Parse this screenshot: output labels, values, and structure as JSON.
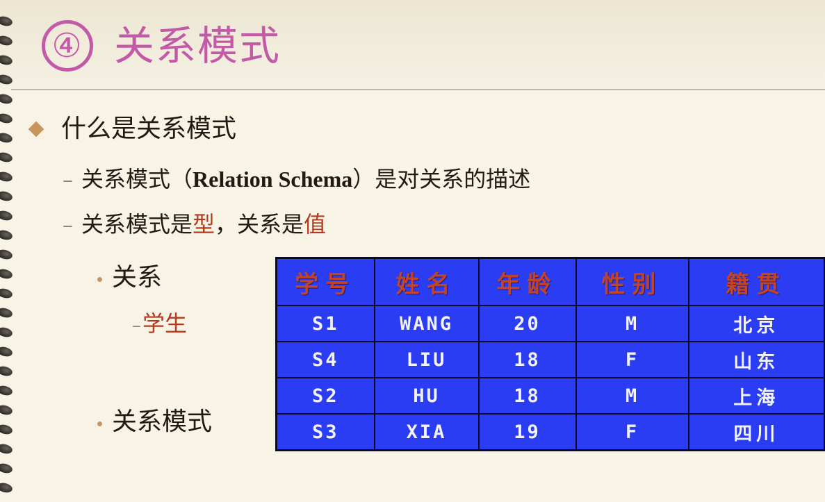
{
  "slide": {
    "title_num": "④",
    "title": "关系模式",
    "bullet1": "什么是关系模式",
    "sub1_cn_pre": "关系模式（",
    "sub1_latin": "Relation Schema",
    "sub1_cn_post": "）是对关系的描述",
    "sub2_pre": "关系模式是",
    "sub2_type": "型",
    "sub2_mid": "，关系是",
    "sub2_value": "值",
    "bullet3a": "关系",
    "bullet4": "学生",
    "bullet3b": "关系模式"
  },
  "table": {
    "headers": [
      "学号",
      "姓名",
      "年龄",
      "性别",
      "籍贯"
    ],
    "rows": [
      [
        "S1",
        "WANG",
        "20",
        "M",
        "北京"
      ],
      [
        "S4",
        "LIU",
        "18",
        "F",
        "山东"
      ],
      [
        "S2",
        "HU",
        "18",
        "M",
        "上海"
      ],
      [
        "S3",
        "XIA",
        "19",
        "F",
        "四川"
      ]
    ]
  },
  "colors": {
    "title": "#c25aa7",
    "highlight": "#b23a1e",
    "table_bg": "#2a3df2",
    "table_header_text": "#c0442a"
  }
}
